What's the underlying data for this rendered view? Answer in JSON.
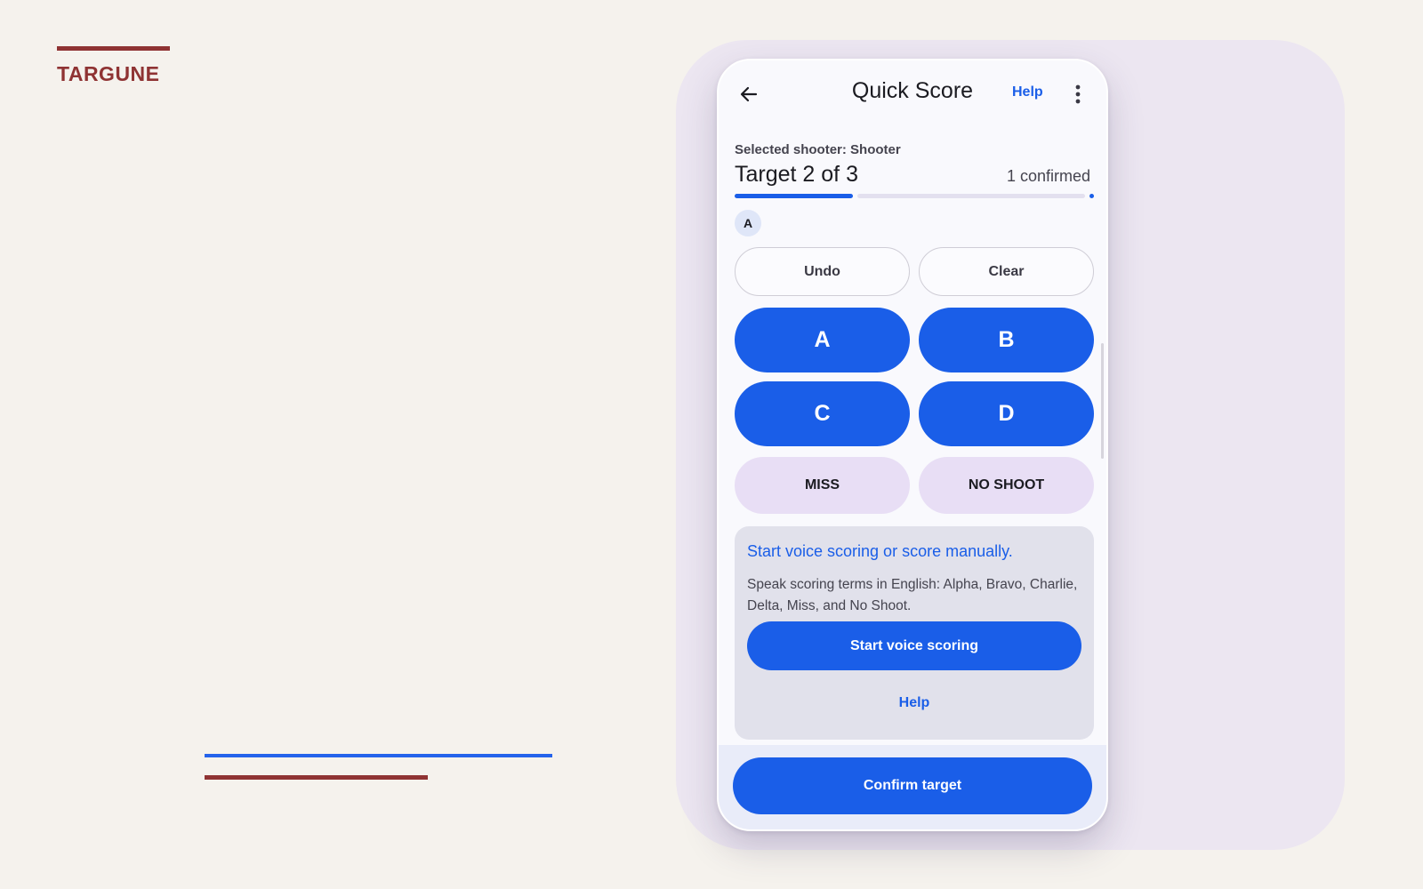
{
  "brand": {
    "name": "TARGUNE"
  },
  "appbar": {
    "title": "Quick Score",
    "help_label": "Help",
    "back_icon": "arrow-left-icon",
    "more_icon": "more-vertical-icon"
  },
  "status": {
    "selected_shooter": "Selected shooter: Shooter",
    "target_label": "Target 2 of 3",
    "confirmed_label": "1 confirmed",
    "progress": 0.33
  },
  "hits": [
    "A"
  ],
  "actions": {
    "undo_label": "Undo",
    "clear_label": "Clear"
  },
  "scoring": {
    "buttons": [
      "A",
      "B",
      "C",
      "D"
    ],
    "miss_label": "MISS",
    "no_shoot_label": "NO SHOOT"
  },
  "voice": {
    "title": "Start voice scoring or score manually.",
    "description": "Speak scoring terms in English: Alpha, Bravo, Charlie, Delta, Miss, and No Shoot.",
    "start_label": "Start voice scoring",
    "help_label": "Help"
  },
  "footer": {
    "confirm_label": "Confirm target"
  },
  "colors": {
    "accent": "#1a5ee8",
    "brand": "#8f3333",
    "soft": "#e8def5",
    "background": "#f5f2ed"
  }
}
